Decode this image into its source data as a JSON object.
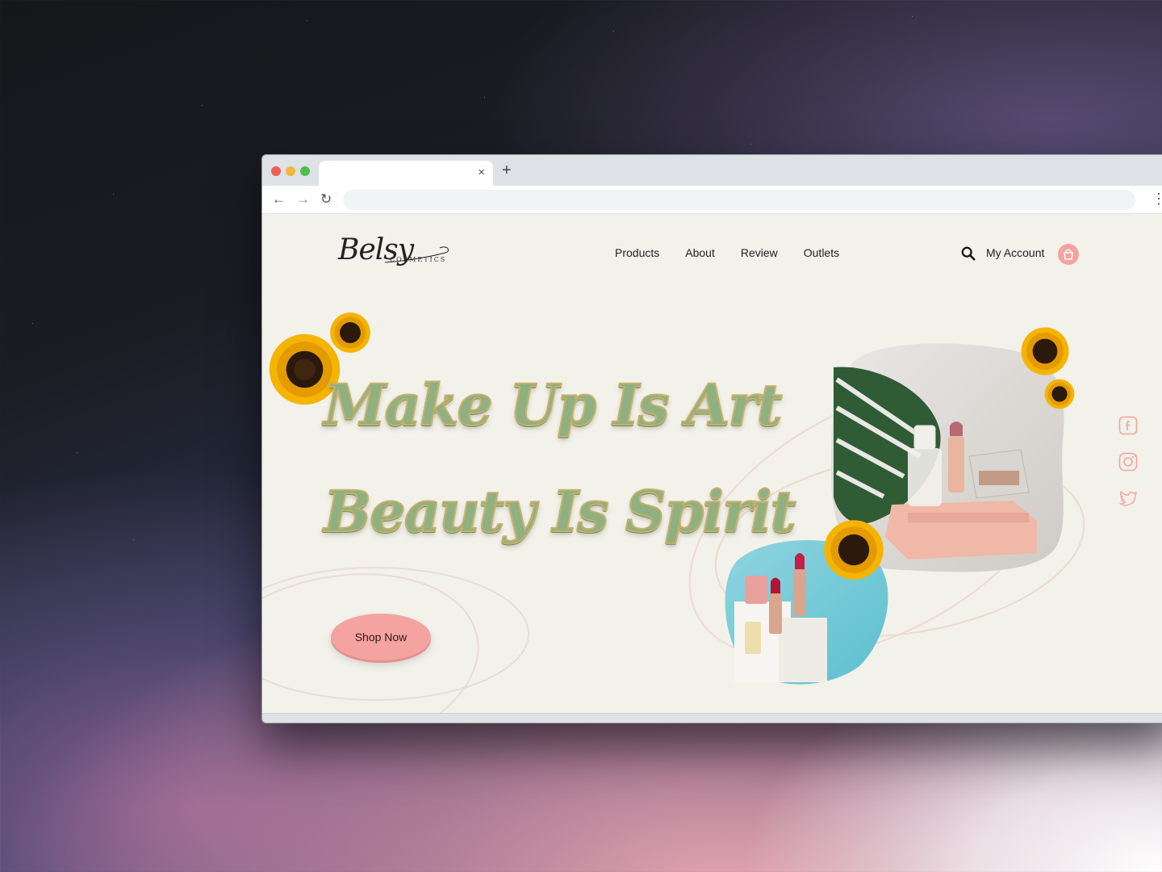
{
  "browser": {
    "tab_close": "×",
    "new_tab": "+",
    "nav_back": "←",
    "nav_forward": "→",
    "reload": "↻",
    "menu": "⋮"
  },
  "site": {
    "logo": {
      "script": "Belsy",
      "subtitle": "COSMETICS"
    },
    "nav": [
      "Products",
      "About",
      "Review",
      "Outlets"
    ],
    "account_label": "My Account",
    "hero": {
      "line1": "Make Up Is Art",
      "line2": "Beauty Is Spirit",
      "cta": "Shop Now"
    },
    "social_icons": [
      "facebook-icon",
      "instagram-icon",
      "twitter-icon"
    ],
    "colors": {
      "page_bg": "#f2f1ea",
      "accent_pink": "#f4a3a0",
      "headline_green": "#8fb081",
      "headline_outline": "#c8b06a"
    }
  }
}
